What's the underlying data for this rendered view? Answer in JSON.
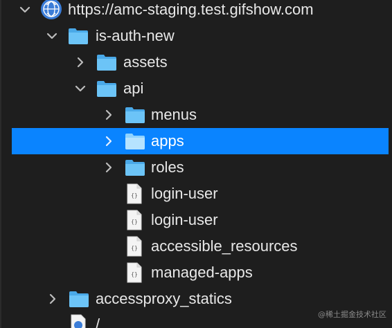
{
  "tree": {
    "root_label": "https://amc-staging.test.gifshow.com",
    "items": [
      {
        "label": "is-auth-new"
      },
      {
        "label": "assets"
      },
      {
        "label": "api"
      },
      {
        "label": "menus"
      },
      {
        "label": "apps"
      },
      {
        "label": "roles"
      },
      {
        "label": "login-user"
      },
      {
        "label": "login-user"
      },
      {
        "label": "accessible_resources"
      },
      {
        "label": "managed-apps"
      },
      {
        "label": "accessproxy_statics"
      },
      {
        "label": "/"
      }
    ]
  },
  "watermark": "@稀土掘金技术社区",
  "colors": {
    "background": "#1e1e1e",
    "selection": "#0a84ff",
    "folder": "#5ac8fa",
    "text": "#e8e8e8"
  }
}
